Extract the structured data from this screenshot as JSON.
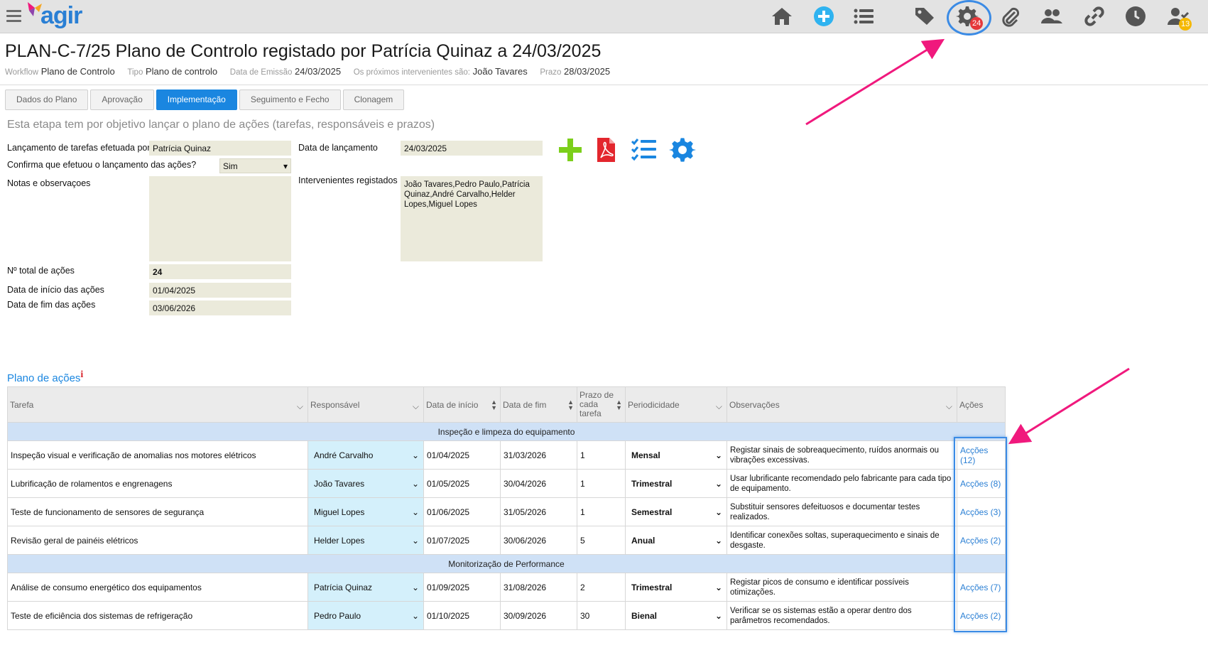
{
  "app": {
    "logo_text": "agir",
    "brand_color": "#2a7fd4"
  },
  "topbar": {
    "icons": [
      "home-icon",
      "add-circle-icon",
      "list-icon",
      "tag-icon",
      "gear-icon",
      "paperclip-icon",
      "users-icon",
      "link-icon",
      "clock-icon",
      "user-check-icon"
    ],
    "gear_badge": "24",
    "user_badge": "13"
  },
  "header": {
    "title": "PLAN-C-7/25 Plano de Controlo registado por Patrícia Quinaz a 24/03/2025",
    "meta": [
      {
        "key": "Workflow",
        "value": "Plano de Controlo"
      },
      {
        "key": "Tipo",
        "value": "Plano de controlo"
      },
      {
        "key": "Data de Emissão",
        "value": "24/03/2025"
      },
      {
        "key": "Os próximos intervenientes são:",
        "value": "João Tavares"
      },
      {
        "key": "Prazo",
        "value": "28/03/2025"
      }
    ]
  },
  "tabs": [
    "Dados do Plano",
    "Aprovação",
    "Implementação",
    "Seguimento e Fecho",
    "Clonagem"
  ],
  "active_tab": "Implementação",
  "stage_description": "Esta etapa tem por objetivo lançar o plano de ações (tarefas, responsáveis e prazos)",
  "form": {
    "lancamento_label": "Lançamento de tarefas efetuada por",
    "lancamento_value": "Patrícia Quinaz",
    "confirma_label": "Confirma que efetuou o lançamento das ações?",
    "confirma_value": "Sim",
    "notas_label": "Notas e observaçoes",
    "notas_value": "",
    "data_lancamento_label": "Data de lançamento",
    "data_lancamento_value": "24/03/2025",
    "intervenientes_label": "Intervenientes registados",
    "intervenientes_value": "João Tavares,Pedro Paulo,Patrícia Quinaz,André Carvalho,Helder Lopes,Miguel Lopes",
    "total_label": "Nº total de ações",
    "total_value": "24",
    "inicio_label": "Data de início das ações",
    "inicio_value": "01/04/2025",
    "fim_label": "Data de fim das ações",
    "fim_value": "03/06/2026"
  },
  "action_icons": [
    "add-icon",
    "pdf-icon",
    "checklist-icon",
    "settings-icon"
  ],
  "section": {
    "title": "Plano de ações",
    "info": "i"
  },
  "table": {
    "headers": {
      "tarefa": "Tarefa",
      "responsavel": "Responsável",
      "inicio": "Data de início",
      "fim": "Data de fim",
      "prazo": "Prazo de cada tarefa",
      "periodicidade": "Periodicidade",
      "observacoes": "Observações",
      "acoes": "Ações"
    },
    "groups": [
      {
        "name": "Inspeção e limpeza do equipamento",
        "rows": [
          {
            "tarefa": "Inspeção visual e verificação de anomalias nos motores elétricos",
            "responsavel": "André Carvalho",
            "inicio": "01/04/2025",
            "fim": "31/03/2026",
            "prazo": "1",
            "periodicidade": "Mensal",
            "observacoes": "Registar sinais de sobreaquecimento, ruídos anormais ou vibrações excessivas.",
            "acoes": "Acções (12)"
          },
          {
            "tarefa": "Lubrificação de rolamentos e engrenagens",
            "responsavel": "João Tavares",
            "inicio": "01/05/2025",
            "fim": "30/04/2026",
            "prazo": "1",
            "periodicidade": "Trimestral",
            "observacoes": "Usar lubrificante recomendado pelo fabricante para cada tipo de equipamento.",
            "acoes": "Acções (8)"
          },
          {
            "tarefa": "Teste de funcionamento de sensores de segurança",
            "responsavel": "Miguel Lopes",
            "inicio": "01/06/2025",
            "fim": "31/05/2026",
            "prazo": "1",
            "periodicidade": "Semestral",
            "observacoes": "Substituir sensores defeituosos e documentar testes realizados.",
            "acoes": "Acções (3)"
          },
          {
            "tarefa": "Revisão geral de painéis elétricos",
            "responsavel": "Helder Lopes",
            "inicio": "01/07/2025",
            "fim": "30/06/2026",
            "prazo": "5",
            "periodicidade": "Anual",
            "observacoes": "Identificar conexões soltas, superaquecimento e sinais de desgaste.",
            "acoes": "Acções (2)"
          }
        ]
      },
      {
        "name": "Monitorização de Performance",
        "rows": [
          {
            "tarefa": "Análise de consumo energético dos equipamentos",
            "responsavel": "Patrícia Quinaz",
            "inicio": "01/09/2025",
            "fim": "31/08/2026",
            "prazo": "2",
            "periodicidade": "Trimestral",
            "observacoes": "Registar picos de consumo e identificar possíveis otimizações.",
            "acoes": "Acções (7)"
          },
          {
            "tarefa": "Teste de eficiência dos sistemas de refrigeração",
            "responsavel": "Pedro Paulo",
            "inicio": "01/10/2025",
            "fim": "30/09/2026",
            "prazo": "30",
            "periodicidade": "Bienal",
            "observacoes": "Verificar se os sistemas estão a operar dentro dos parâmetros recomendados.",
            "acoes": "Acções (2)"
          }
        ]
      }
    ]
  },
  "annotation_color": "#f0197d",
  "highlight_color": "#3b8be5"
}
